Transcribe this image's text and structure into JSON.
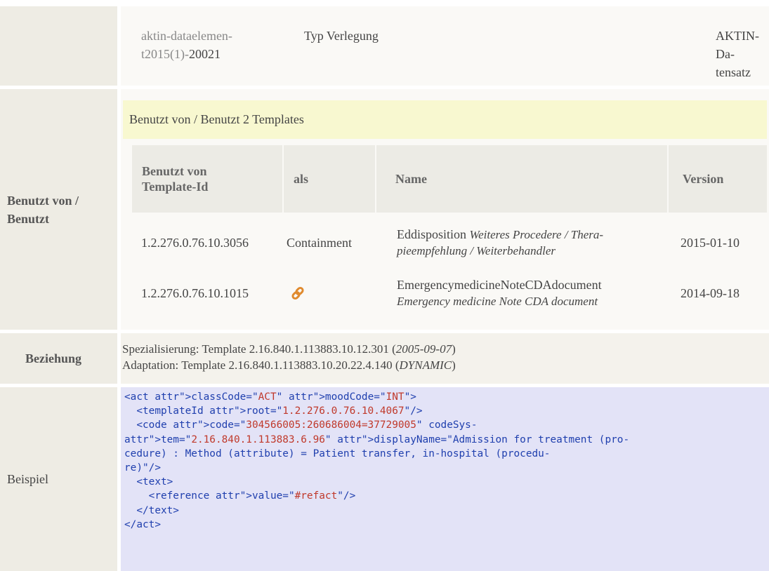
{
  "row_id": {
    "id_part1": "aktin-dataelemen-",
    "id_part2_gray": "t2015(1)-",
    "id_part2_dark": "20021",
    "name": "Typ Verlegung",
    "dataset_line1": "AKTIN-Da-",
    "dataset_line2": "tensatz"
  },
  "uses_section": {
    "label_line1": "Benutzt von /",
    "label_line2": "Benutzt",
    "header": "Benutzt von / Benutzt 2 Templates",
    "columns": {
      "template_id_line1": "Benutzt von",
      "template_id_line2": "Template-Id",
      "as": "als",
      "name": "Name",
      "version": "Version"
    },
    "rows": [
      {
        "template_id": "1.2.276.0.76.10.3056",
        "as": "Containment",
        "name": "Eddisposition",
        "name_italic_1": "Weiteres Procedere / Thera-",
        "name_italic_2": "pieempfehlung / Weiterbehandler",
        "version": "2015-01-10"
      },
      {
        "template_id": "1.2.276.0.76.10.1015",
        "as_icon": "link-icon",
        "name": "EmergencymedicineNoteCDAdocument",
        "name_italic": "Emergency medicine Note CDA document",
        "version": "2014-09-18"
      }
    ]
  },
  "relation": {
    "label": "Beziehung",
    "line1_prefix": "Spezialisierung: Template 2.16.840.1.113883.10.12.301 (",
    "line1_italic": "2005-09-07",
    "line1_suffix": ")",
    "line2_prefix": "Adaptation: Template 2.16.840.1.113883.10.20.22.4.140 (",
    "line2_italic": "DYNAMIC",
    "line2_suffix": ")"
  },
  "example": {
    "label": "Beispiel",
    "code_lines": [
      "<act classCode=\"ACT\" moodCode=\"INT\">",
      "  <templateId root=\"1.2.276.0.76.10.4067\"/>",
      "  <code code=\"304566005:260686004=37729005\" codeSys-",
      "tem=\"2.16.840.1.113883.6.96\" displayName=\"Admission for treatment (pro-",
      "cedure) : Method (attribute) = Patient transfer, in-hospital (procedu-",
      "re)\"/>",
      "  <text>",
      "    <reference value=\"#refact\"/>",
      "  </text>",
      "</act>"
    ]
  },
  "colors": {
    "label_bg": "#eeece4",
    "uses_header_bg": "#f8f8d0",
    "code_bg": "#e3e3f7",
    "code_tag": "#1f3fae",
    "code_attr": "#d26a2a",
    "code_value": "#c0392b",
    "link_icon": "#e08a2e"
  }
}
